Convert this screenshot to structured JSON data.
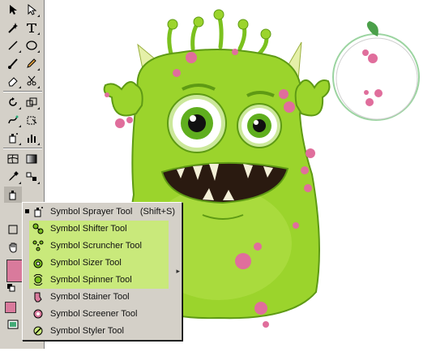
{
  "toolbox": {
    "icons": [
      "selection-arrow",
      "direct-select",
      "magic-wand",
      "type",
      "line",
      "ellipse",
      "paintbrush",
      "pencil",
      "eraser",
      "scissors",
      "rotate",
      "scale",
      "warp",
      "free-transform",
      "symbol-sprayer",
      "column-graph",
      "mesh",
      "gradient",
      "eyedropper",
      "blend",
      "slice",
      "hand",
      "zoom"
    ]
  },
  "flyout": {
    "items": [
      {
        "label": "Symbol Sprayer Tool",
        "shortcut": "(Shift+S)",
        "icon": "sprayer-icon"
      },
      {
        "label": "Symbol Shifter Tool",
        "shortcut": "",
        "icon": "shifter-icon"
      },
      {
        "label": "Symbol Scruncher Tool",
        "shortcut": "",
        "icon": "scruncher-icon"
      },
      {
        "label": "Symbol Sizer Tool",
        "shortcut": "",
        "icon": "sizer-icon"
      },
      {
        "label": "Symbol Spinner Tool",
        "shortcut": "",
        "icon": "spinner-icon"
      },
      {
        "label": "Symbol Stainer Tool",
        "shortcut": "",
        "icon": "stainer-icon"
      },
      {
        "label": "Symbol Screener Tool",
        "shortcut": "",
        "icon": "screener-icon"
      },
      {
        "label": "Symbol Styler Tool",
        "shortcut": "",
        "icon": "styler-icon"
      }
    ]
  },
  "colors": {
    "monster_green": "#9bd42c",
    "monster_dark": "#5e9a14",
    "spot_pink": "#e06e9c",
    "fill_swatch": "#d97a9c",
    "highlight": "#c9e97b"
  }
}
